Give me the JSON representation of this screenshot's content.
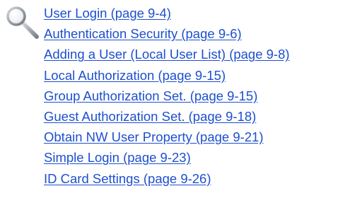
{
  "icon": "magnifying-glass-icon",
  "link_color": "#1d4fcf",
  "links": [
    "User Login (page 9-4)",
    "Authentication Security (page 9-6)",
    "Adding a User (Local User List) (page 9-8)",
    "Local Authorization (page 9-15)",
    "Group Authorization Set. (page 9-15)",
    "Guest Authorization Set. (page 9-18)",
    "Obtain NW User Property (page 9-21)",
    "Simple Login (page 9-23)",
    "ID Card Settings (page 9-26)"
  ]
}
